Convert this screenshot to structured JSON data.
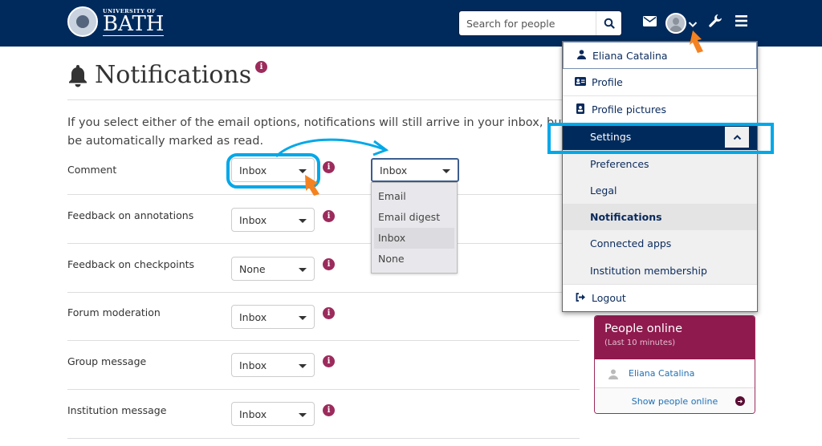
{
  "header": {
    "logo_small": "UNIVERSITY OF",
    "logo_big": "BATH",
    "search_placeholder": "Search for people",
    "icons": [
      "search-icon",
      "envelope-icon",
      "avatar",
      "chevron-down-icon",
      "wrench-icon",
      "hamburger-menu-icon"
    ]
  },
  "page": {
    "title": "Notifications",
    "intro": "If you select either of the email options, notifications will still arrive in your inbox, but they will be automatically marked as read."
  },
  "intro_lines": [
    "If you select either of the email options, notifications will still arrive in your inbox, but they",
    "be automatically marked as read."
  ],
  "notification_rows": [
    {
      "label": "Comment",
      "value": "Inbox"
    },
    {
      "label": "Feedback on annotations",
      "value": "Inbox"
    },
    {
      "label": "Feedback on checkpoints",
      "value": "None"
    },
    {
      "label": "Forum moderation",
      "value": "Inbox"
    },
    {
      "label": "Group message",
      "value": "Inbox"
    },
    {
      "label": "Institution message",
      "value": "Inbox"
    }
  ],
  "open_dropdown": {
    "value": "Inbox",
    "options": [
      "Email",
      "Email digest",
      "Inbox",
      "None"
    ],
    "highlighted": "Inbox"
  },
  "user_menu": {
    "user_name": "Eliana Catalina",
    "items": [
      {
        "label": "Profile",
        "icon": "id-card-icon"
      },
      {
        "label": "Profile pictures",
        "icon": "portrait-icon"
      }
    ],
    "settings_label": "Settings",
    "settings_sub": [
      {
        "label": "Preferences",
        "active": false
      },
      {
        "label": "Legal",
        "active": false
      },
      {
        "label": "Notifications",
        "active": true
      },
      {
        "label": "Connected apps",
        "active": false
      },
      {
        "label": "Institution membership",
        "active": false
      }
    ],
    "logout_label": "Logout"
  },
  "people_online": {
    "title": "People online",
    "subtitle": "(Last 10 minutes)",
    "users": [
      "Eliana Catalina"
    ],
    "show_link": "Show people online"
  },
  "annotation_colors": {
    "highlight": "#00a8e8",
    "pointer": "#f58220"
  }
}
